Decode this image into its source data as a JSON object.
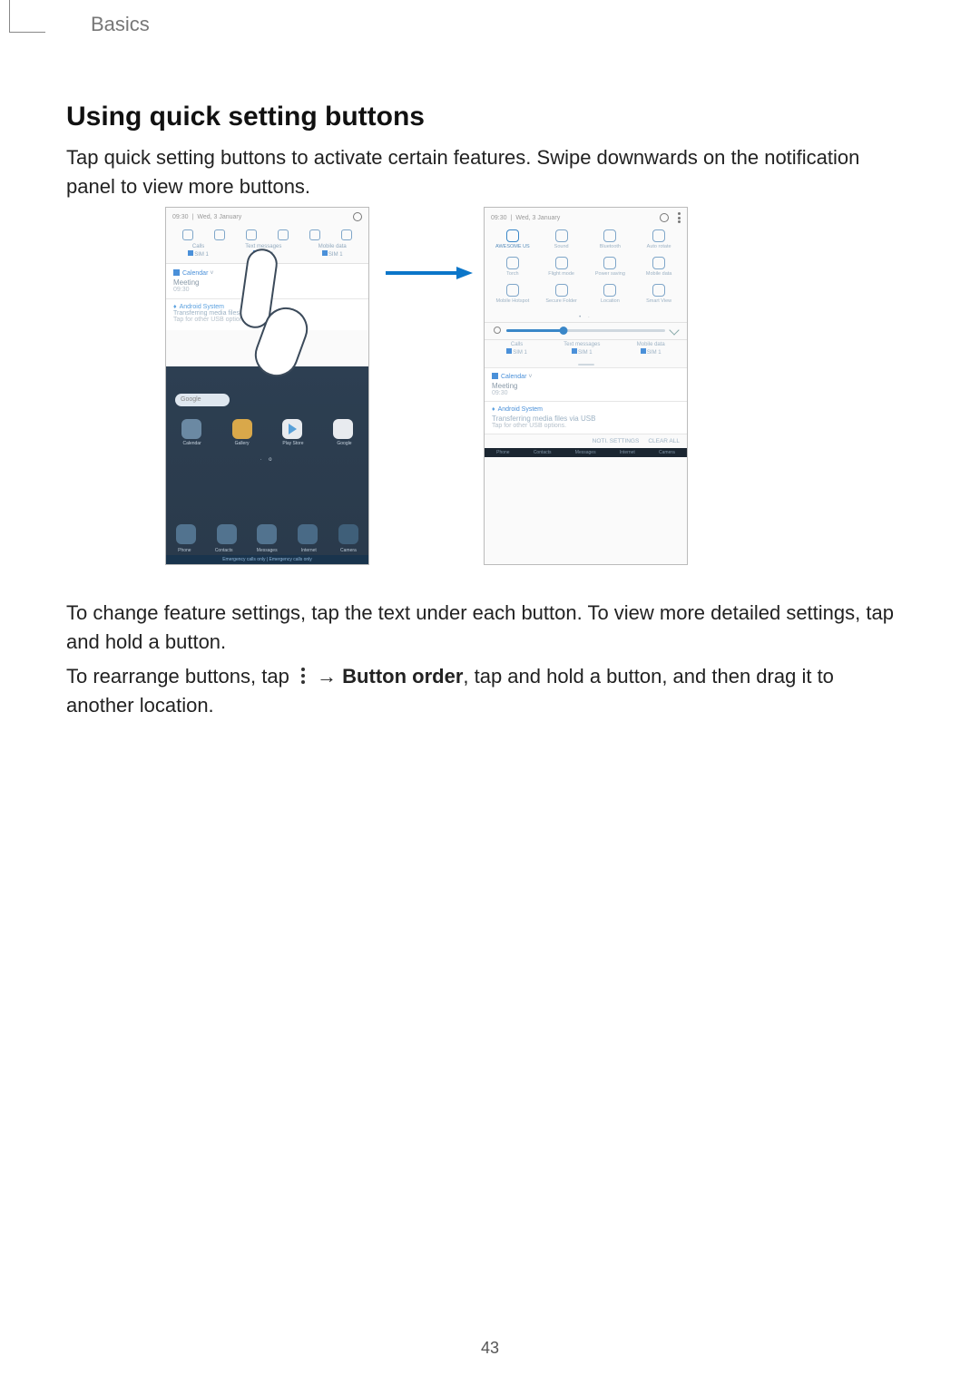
{
  "header": {
    "breadcrumb": "Basics"
  },
  "content": {
    "heading": "Using quick setting buttons",
    "para1": "Tap quick setting buttons to activate certain features. Swipe downwards on the notification panel to view more buttons.",
    "para2": "To change feature settings, tap the text under each button. To view more detailed settings, tap and hold a button.",
    "para3_pre": "To rearrange buttons, tap ",
    "para3_arrow": " → ",
    "para3_bold": "Button order",
    "para3_post": ", tap and hold a button, and then drag it to another location."
  },
  "phoneA": {
    "status_time": "09:30",
    "status_date": "Wed, 3 January",
    "top_icons": [
      "wifi",
      "sound",
      "bluetooth",
      "rotate",
      "torch",
      "flight"
    ],
    "sim_labels": [
      {
        "title": "Calls",
        "sub": "SIM 1"
      },
      {
        "title": "Text messages",
        "sub": "SIM 1"
      },
      {
        "title": "Mobile data",
        "sub": "SIM 1"
      }
    ],
    "card_calendar": {
      "app": "Calendar",
      "title": "Meeting",
      "time": "09:30"
    },
    "card_system": {
      "app": "Android System",
      "title": "Transferring media files via USB",
      "sub": "Tap for other USB options."
    },
    "google": "Google",
    "apps_r1": [
      "Calendar",
      "Gallery",
      "Play Store",
      "Google"
    ],
    "pager": "·  o",
    "dock": [
      "Phone",
      "Contacts",
      "Messages",
      "Internet",
      "Camera"
    ],
    "footer": "Emergency calls only | Emergency calls only"
  },
  "phoneB": {
    "status_time": "09:30",
    "status_date": "Wed, 3 January",
    "grid": [
      {
        "label": "AWESOME US",
        "on": true
      },
      {
        "label": "Sound",
        "on": false
      },
      {
        "label": "Bluetooth",
        "on": false
      },
      {
        "label": "Auto rotate",
        "on": false
      },
      {
        "label": "Torch",
        "on": false
      },
      {
        "label": "Flight mode",
        "on": false
      },
      {
        "label": "Power saving",
        "on": false
      },
      {
        "label": "Mobile data",
        "on": false
      },
      {
        "label": "Mobile Hotspot",
        "on": false
      },
      {
        "label": "Secure Folder",
        "on": false
      },
      {
        "label": "Location",
        "on": false
      },
      {
        "label": "Smart View",
        "on": false
      }
    ],
    "pager": "•  ·",
    "sim_labels": [
      {
        "title": "Calls",
        "sub": "SIM 1"
      },
      {
        "title": "Text messages",
        "sub": "SIM 1"
      },
      {
        "title": "Mobile data",
        "sub": "SIM 1"
      }
    ],
    "card_calendar": {
      "app": "Calendar",
      "title": "Meeting",
      "time": "09:30"
    },
    "card_system": {
      "app": "Android System",
      "title": "Transferring media files via USB",
      "sub": "Tap for other USB options."
    },
    "bottom": {
      "settings": "NOTI. SETTINGS",
      "clear": "CLEAR ALL"
    },
    "nav": [
      "Phone",
      "Contacts",
      "Messages",
      "Internet",
      "Camera"
    ]
  },
  "page_number": "43"
}
